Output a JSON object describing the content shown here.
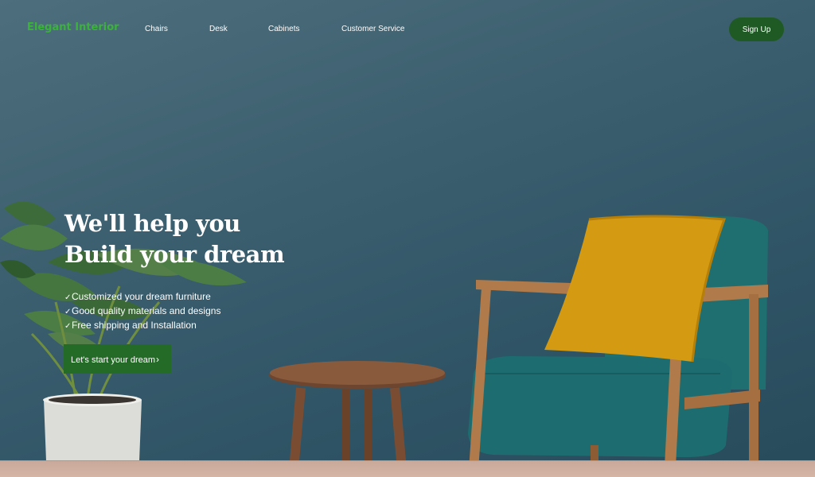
{
  "brand": {
    "logo_text": "Elegant Interior"
  },
  "nav": {
    "items": [
      {
        "label": "Chairs"
      },
      {
        "label": "Desk"
      },
      {
        "label": "Cabinets"
      },
      {
        "label": "Customer Service"
      }
    ],
    "signup_label": "Sign Up"
  },
  "hero": {
    "headline_line1": "We'll help you",
    "headline_line2": "Build your dream",
    "features": [
      {
        "check": "✓",
        "text": "Customized your dream furniture"
      },
      {
        "check": "✓",
        "text": "Good quality materials and designs"
      },
      {
        "check": "✓",
        "text": "Free shipping and Installation"
      }
    ],
    "cta_label": "Let's start your dream",
    "cta_icon": "›"
  },
  "colors": {
    "logo": "#3bb33b",
    "button_green": "#1f5a25",
    "wall": "#2f5465"
  },
  "icons": {
    "check": "check-icon",
    "cta_arrow": "chevron-right-icon"
  }
}
